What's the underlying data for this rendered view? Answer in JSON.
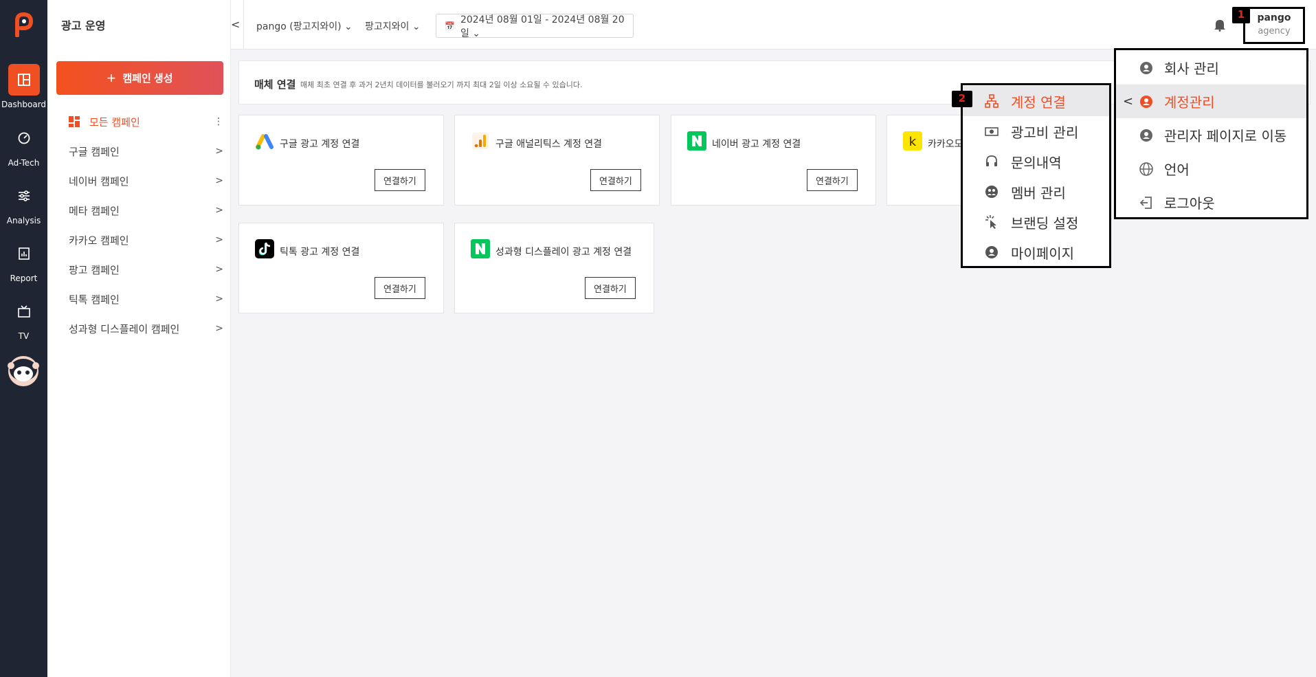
{
  "rail": {
    "items": [
      {
        "label": "Dashboard",
        "icon": "dashboard-icon"
      },
      {
        "label": "Ad-Tech",
        "icon": "gauge-icon"
      },
      {
        "label": "Analysis",
        "icon": "sliders-icon"
      },
      {
        "label": "Report",
        "icon": "report-icon"
      },
      {
        "label": "TV",
        "icon": "tv-icon"
      }
    ]
  },
  "sidenav": {
    "title": "광고 운영",
    "create_label": "캠페인 생성",
    "items": [
      {
        "label": "모든 캠페인"
      },
      {
        "label": "구글 캠페인"
      },
      {
        "label": "네이버 캠페인"
      },
      {
        "label": "메타 캠페인"
      },
      {
        "label": "카카오 캠페인"
      },
      {
        "label": "팡고 캠페인"
      },
      {
        "label": "틱톡 캠페인"
      },
      {
        "label": "성과형 디스플레이 캠페인"
      }
    ]
  },
  "topbar": {
    "account_select": "pango (팡고지와이) ⌄",
    "brand_select": "팡고지와이 ⌄",
    "date_range": "2024년 08월 01일 - 2024년 08월 20일 ⌄",
    "user_name": "pango",
    "user_role": "agency"
  },
  "notice": {
    "heading": "매체 연결",
    "desc": "매체 최초 연결 후 과거 2년치 데이터를 불러오기 까지 최대 2일 이상 소요될 수 있습니다."
  },
  "cards": [
    {
      "name": "구글 광고 계정 연결",
      "button": "연결하기",
      "icon": "google-ads-icon"
    },
    {
      "name": "구글 애널리틱스 계정 연결",
      "button": "연결하기",
      "icon": "google-analytics-icon"
    },
    {
      "name": "네이버 광고 계정 연결",
      "button": "연결하기",
      "icon": "naver-icon"
    },
    {
      "name": "카카오모",
      "button": "",
      "icon": "kakao-icon"
    },
    {
      "name": "틱톡 광고 계정 연결",
      "button": "연결하기",
      "icon": "tiktok-icon"
    },
    {
      "name": "성과형 디스플레이 광고 계정 연결",
      "button": "연결하기",
      "icon": "naver-display-icon"
    }
  ],
  "menu_main": {
    "items": [
      {
        "label": "회사 관리",
        "icon": "company-gear-icon"
      },
      {
        "label": "계정관리",
        "icon": "account-gear-icon"
      },
      {
        "label": "관리자 페이지로 이동",
        "icon": "admin-gear-icon"
      },
      {
        "label": "언어",
        "icon": "globe-icon"
      },
      {
        "label": "로그아웃",
        "icon": "logout-icon"
      }
    ]
  },
  "menu_sub": {
    "items": [
      {
        "label": "계정 연결",
        "icon": "network-icon"
      },
      {
        "label": "광고비 관리",
        "icon": "money-icon"
      },
      {
        "label": "문의내역",
        "icon": "headset-icon"
      },
      {
        "label": "멤버 관리",
        "icon": "members-icon"
      },
      {
        "label": "브랜딩 설정",
        "icon": "cursor-click-icon"
      },
      {
        "label": "마이페이지",
        "icon": "user-circle-icon"
      }
    ]
  },
  "badges": {
    "first": "1",
    "second": "2"
  },
  "colors": {
    "accent": "#f04e23",
    "rail_bg": "#1f2533"
  }
}
